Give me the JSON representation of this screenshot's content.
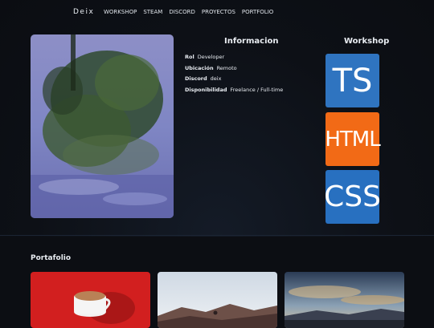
{
  "nav": {
    "brand": "Deix",
    "links": [
      "WORKSHOP",
      "STEAM",
      "DISCORD",
      "PROYECTOS",
      "PORTFOLIO"
    ]
  },
  "info": {
    "title": "Informacion",
    "rows": [
      {
        "label": "Rol",
        "value": "Developer"
      },
      {
        "label": "Ubicación",
        "value": "Remoto"
      },
      {
        "label": "Discord",
        "value": "deix"
      },
      {
        "label": "Disponibilidad",
        "value": "Freelance / Full-time"
      }
    ]
  },
  "workshop": {
    "title": "Workshop",
    "icons": [
      {
        "label": "TS",
        "color": "#2f74c0"
      },
      {
        "label": "HTML",
        "color": "#f26a16"
      },
      {
        "label": "CSS",
        "color": "#2870c0"
      }
    ]
  },
  "portfolio": {
    "title": "Portafolio"
  }
}
